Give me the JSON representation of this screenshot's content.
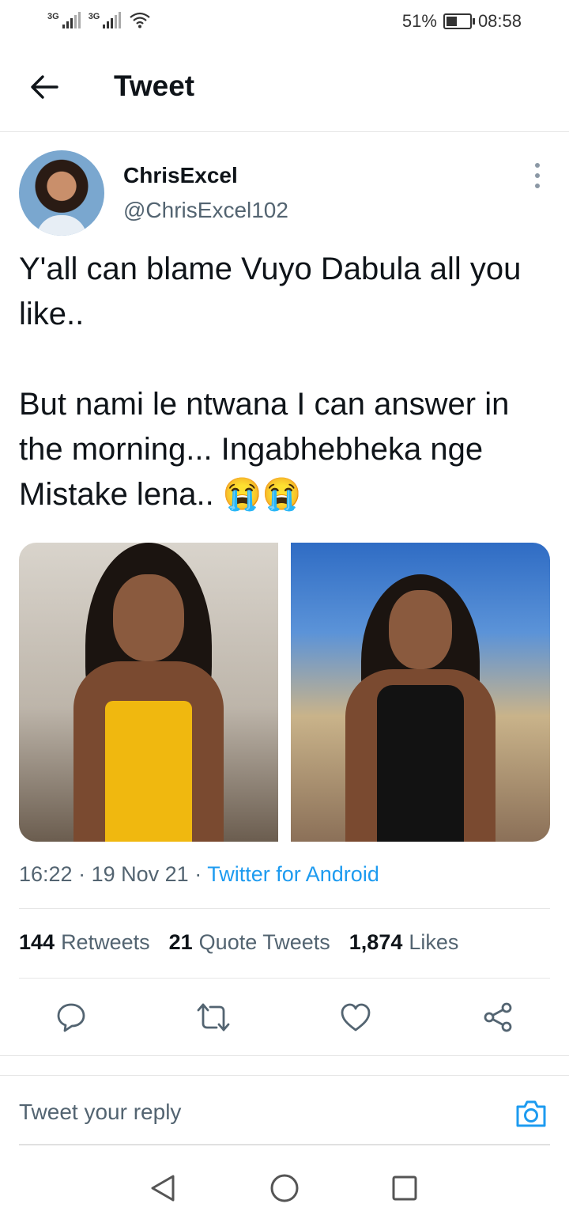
{
  "status_bar": {
    "network_1": "3G",
    "network_2": "3G",
    "battery_percent": "51%",
    "battery_level": 0.51,
    "time": "08:58"
  },
  "header": {
    "title": "Tweet"
  },
  "tweet": {
    "display_name": "ChrisExcel",
    "handle": "@ChrisExcel102",
    "text": "Y'all can blame Vuyo Dabula all you like..\n\nBut nami le ntwana I can answer in the morning... Ingabhebheka nge Mistake lena.. 😭😭",
    "time": "16:22",
    "date": "19 Nov 21",
    "source": "Twitter for Android",
    "separator": "·"
  },
  "stats": {
    "retweets_count": "144",
    "retweets_label": "Retweets",
    "quotes_count": "21",
    "quotes_label": "Quote Tweets",
    "likes_count": "1,874",
    "likes_label": "Likes"
  },
  "reply": {
    "placeholder": "Tweet your reply"
  },
  "colors": {
    "accent": "#1d9bf0",
    "text": "#0f1419",
    "secondary": "#536471"
  },
  "icons": [
    "back-arrow-icon",
    "more-vertical-icon",
    "reply-icon",
    "retweet-icon",
    "like-icon",
    "share-icon",
    "camera-icon",
    "nav-back-icon",
    "nav-home-icon",
    "nav-recents-icon"
  ]
}
